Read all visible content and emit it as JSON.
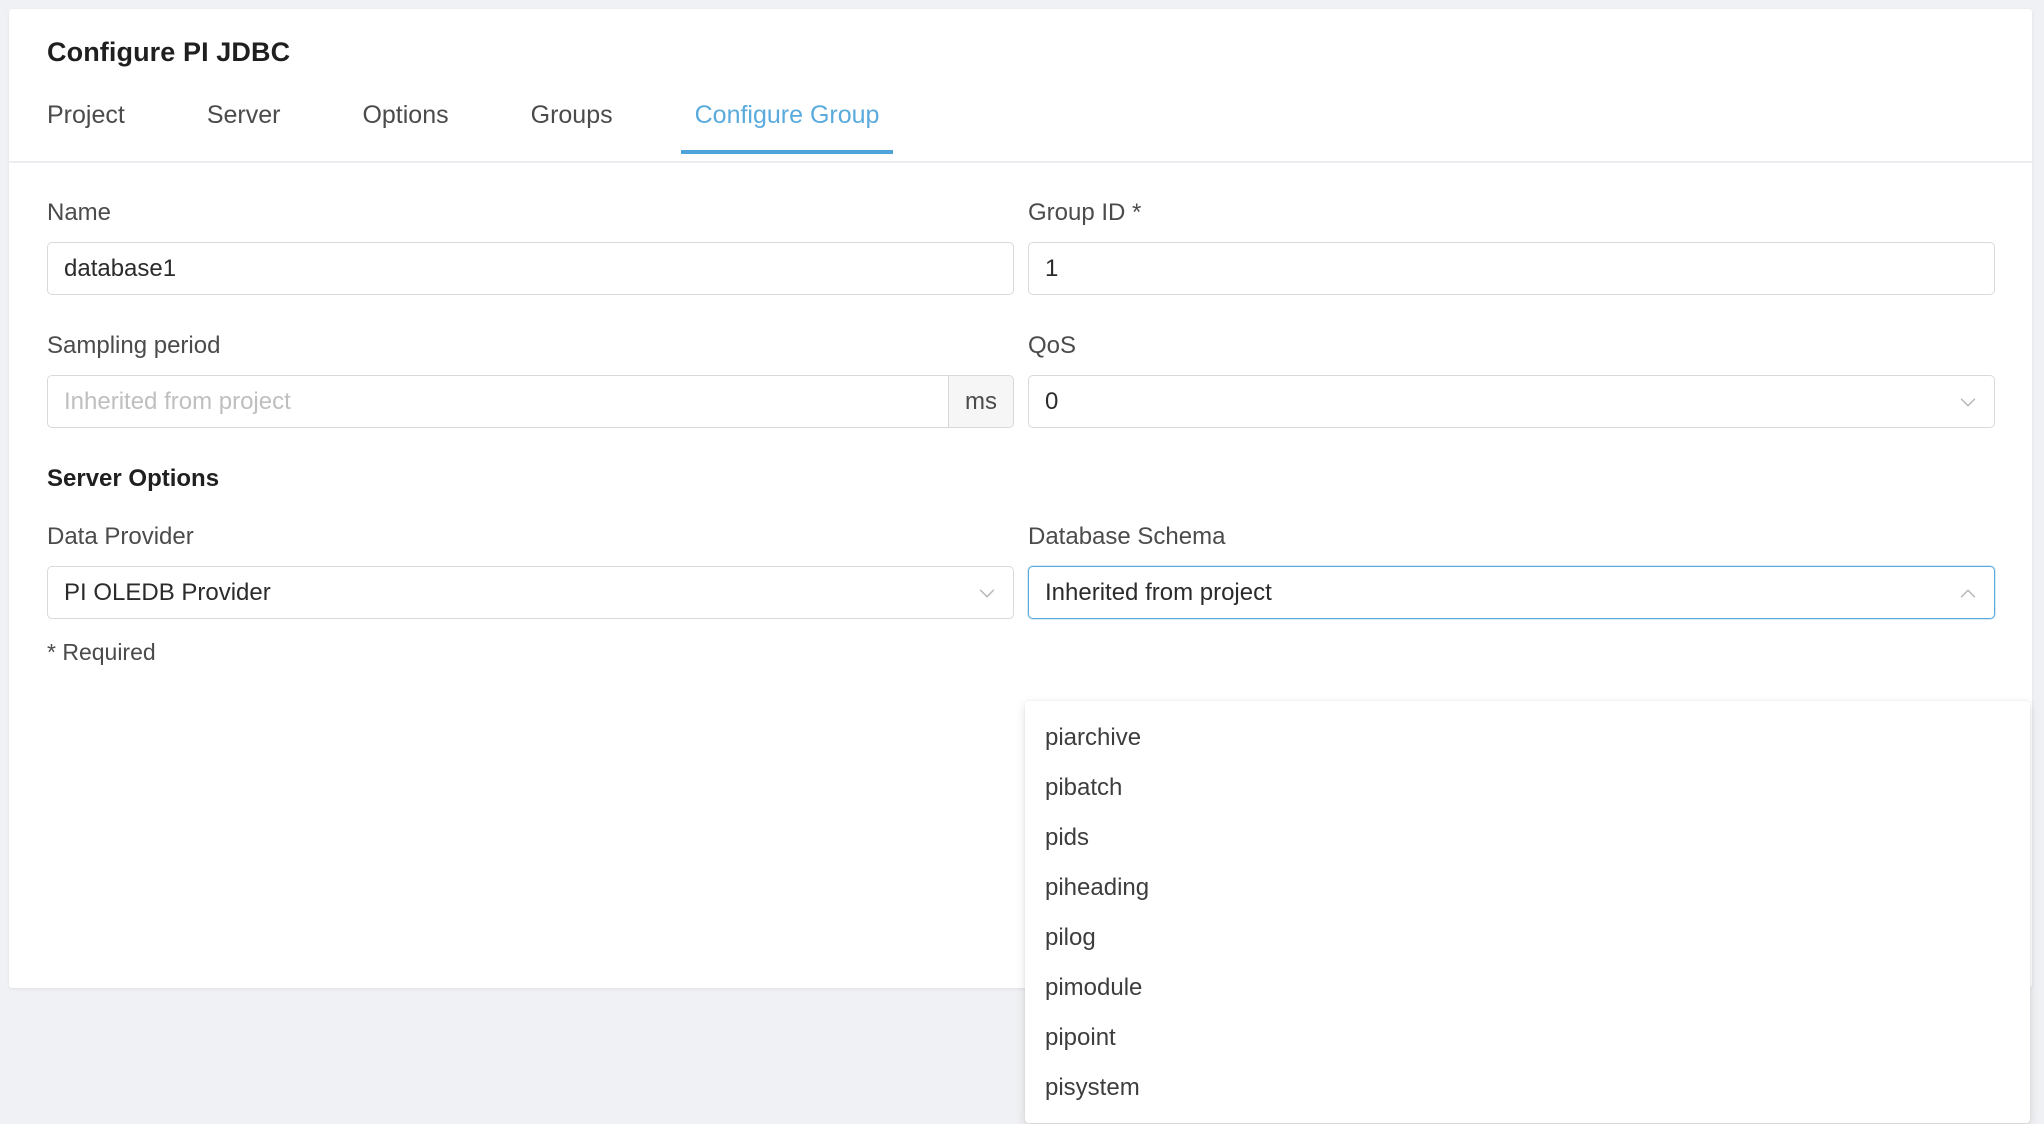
{
  "card": {
    "title": "Configure PI JDBC"
  },
  "tabs": [
    {
      "label": "Project",
      "active": false
    },
    {
      "label": "Server",
      "active": false
    },
    {
      "label": "Options",
      "active": false
    },
    {
      "label": "Groups",
      "active": false
    },
    {
      "label": "Configure Group",
      "active": true
    }
  ],
  "fields": {
    "name": {
      "label": "Name",
      "value": "database1"
    },
    "group_id": {
      "label": "Group ID *",
      "value": "1"
    },
    "sampling_period": {
      "label": "Sampling period",
      "value": "",
      "placeholder": "Inherited from project",
      "unit": "ms"
    },
    "qos": {
      "label": "QoS",
      "value": "0",
      "chevron": "chevron-down-icon"
    },
    "data_provider": {
      "label": "Data Provider",
      "value": "PI OLEDB Provider",
      "chevron": "chevron-down-icon"
    },
    "database_schema": {
      "label": "Database Schema",
      "value": "Inherited from project",
      "chevron": "chevron-up-icon"
    }
  },
  "server_options": {
    "heading": "Server Options"
  },
  "footer": {
    "required_note": "* Required"
  },
  "schema_dropdown": {
    "open": true,
    "options": [
      "piarchive",
      "pibatch",
      "pids",
      "piheading",
      "pilog",
      "pimodule",
      "pipoint",
      "pisystem"
    ]
  },
  "colors": {
    "accent": "#4fa3da",
    "accent_text": "#5aabdd",
    "page_background": "#f0f1f4",
    "card_background": "#ffffff",
    "border": "#d9d9d9",
    "text": "#4b4b4b",
    "placeholder": "#bfbfbf"
  }
}
